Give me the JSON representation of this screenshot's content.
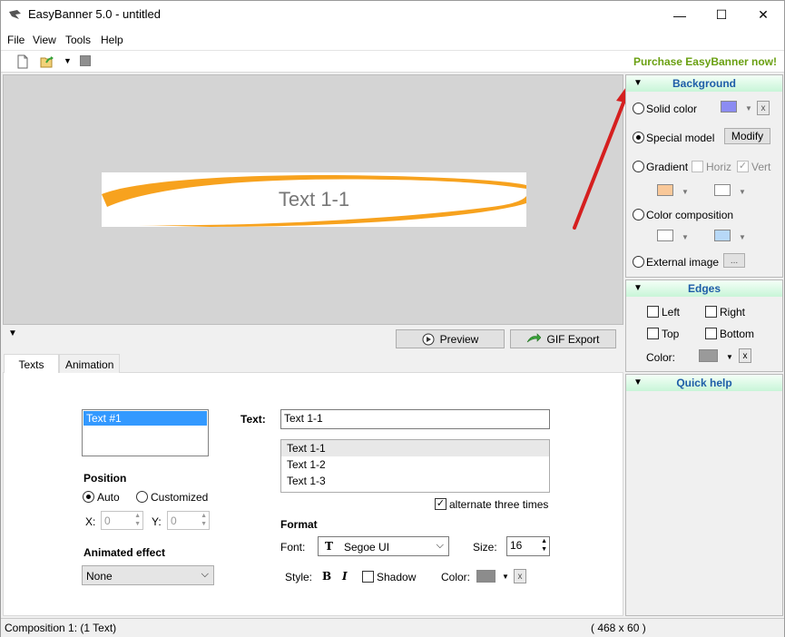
{
  "window": {
    "title": "EasyBanner 5.0 - untitled",
    "minimize_glyph": "—",
    "maximize_glyph": "☐",
    "close_glyph": "✕"
  },
  "menu": {
    "file": "File",
    "view": "View",
    "tools": "Tools",
    "help": "Help"
  },
  "toolbar": {
    "purchase": "Purchase EasyBanner now!"
  },
  "canvas": {
    "banner_text": "Text 1-1"
  },
  "preview_bar": {
    "preview": "Preview",
    "gif_export": "GIF Export"
  },
  "tabs": {
    "texts": "Texts",
    "animation": "Animation"
  },
  "texts_panel": {
    "list_items": [
      "Text #1"
    ],
    "text_label": "Text:",
    "text_value": "Text 1-1",
    "variants": [
      "Text 1-1",
      "Text 1-2",
      "Text 1-3"
    ],
    "alternate_label": "alternate three times",
    "position_label": "Position",
    "auto_label": "Auto",
    "customized_label": "Customized",
    "x_label": "X:",
    "x_value": "0",
    "y_label": "Y:",
    "y_value": "0",
    "animated_effect_label": "Animated effect",
    "animated_effect_value": "None",
    "format_label": "Format",
    "font_label": "Font:",
    "font_value": "Segoe UI",
    "size_label": "Size:",
    "size_value": "16",
    "style_label": "Style:",
    "bold_glyph": "B",
    "italic_glyph": "I",
    "shadow_label": "Shadow",
    "color_label": "Color:",
    "clear_glyph": "x"
  },
  "background_panel": {
    "title": "Background",
    "solid_color": "Solid color",
    "special_model": "Special model",
    "modify": "Modify",
    "gradient": "Gradient",
    "horiz": "Horiz",
    "vert": "Vert",
    "color_composition": "Color composition",
    "external_image": "External image",
    "ellipsis": "...",
    "clear_glyph": "x"
  },
  "edges_panel": {
    "title": "Edges",
    "left": "Left",
    "right": "Right",
    "top": "Top",
    "bottom": "Bottom",
    "color_label": "Color:",
    "clear_glyph": "x"
  },
  "quick_help": {
    "title": "Quick help"
  },
  "statusbar": {
    "composition": "Composition 1:  (1 Text)",
    "size": "( 468 x 60 )"
  },
  "colors": {
    "solid_swatch": "#8c8cf2",
    "gradient_swatch_1": "#f9c899",
    "gradient_swatch_2": "#ffffff",
    "composition_swatch_1": "#ffffff",
    "composition_swatch_2": "#b7d8f7",
    "edge_color": "#9a9a9a",
    "text_color": "#8c8c8c",
    "banner_swoosh": "#f7a21e",
    "arrow": "#d51f1f"
  }
}
